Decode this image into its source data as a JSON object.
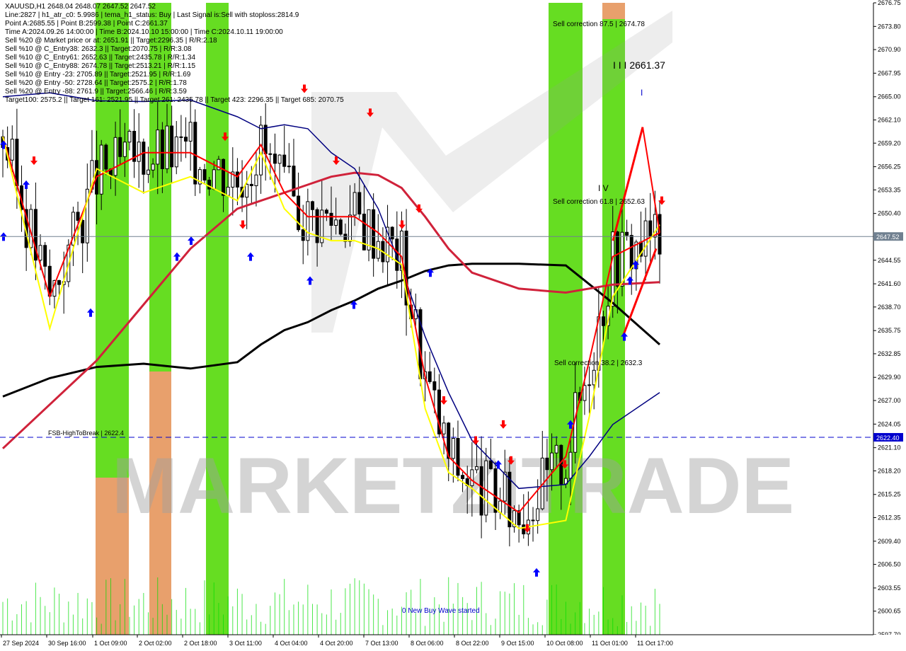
{
  "header": {
    "symbol_line": "XAUUSD,H1  2648.04 2648.07 2647.52 2647.52",
    "info_lines": [
      "Line:2827 | h1_atr_c0: 5.9986 | tema_h1_status: Buy | Last Signal is:Sell with stoploss:2814.9",
      "Point A:2685.55 | Point B:2599.38 | Point C:2661.37",
      "Time A:2024.09.26 14:00:00 | Time B:2024.10.10 15:00:00 | Time C:2024.10.11 19:00:00",
      "Sell %20 @ Market price or at: 2651.91 || Target:2296.35 | R/R:2.18",
      "Sell %10 @ C_Entry38: 2632.3 || Target:2070.75 | R/R:3.08",
      "Sell %10 @ C_Entry61: 2652.63 || Target:2435.78 | R/R:1.34",
      "Sell %10 @ C_Entry88: 2674.78 || Target:2513.21 | R/R:1.15",
      "Sell %10 @ Entry -23: 2705.89 || Target:2521.95 | R/R:1.69",
      "Sell %20 @ Entry -50: 2728.64 || Target:2575.2 | R/R:1.78",
      "Sell %20 @ Entry -88: 2761.9 || Target:2566.46 | R/R:3.59",
      "Target100: 2575.2 || Target 161: 2521.95 || Target 261: 2435.78 || Target 423: 2296.35 || Target 685: 2070.75"
    ]
  },
  "chart_data": {
    "type": "line",
    "symbol": "XAUUSD",
    "timeframe": "H1",
    "ylim": [
      2597.7,
      2676.75
    ],
    "y_ticks": [
      2676.75,
      2673.8,
      2670.9,
      2667.95,
      2665.0,
      2662.1,
      2659.2,
      2656.25,
      2653.35,
      2650.4,
      2647.5,
      2644.55,
      2641.6,
      2638.7,
      2635.75,
      2632.85,
      2629.9,
      2627.0,
      2624.05,
      2621.1,
      2618.2,
      2615.25,
      2612.35,
      2609.4,
      2606.5,
      2603.55,
      2600.65,
      2597.7
    ],
    "x_ticks": [
      "27 Sep 2024",
      "30 Sep 16:00",
      "1 Oct 09:00",
      "2 Oct 02:00",
      "2 Oct 18:00",
      "3 Oct 11:00",
      "4 Oct 04:00",
      "4 Oct 20:00",
      "7 Oct 13:00",
      "8 Oct 06:00",
      "8 Oct 22:00",
      "9 Oct 15:00",
      "10 Oct 08:00",
      "11 Oct 01:00",
      "11 Oct 17:00"
    ],
    "current_price": {
      "value": 2647.52,
      "label": "2647.52"
    },
    "level_line": {
      "value": 2622.4,
      "label": "2622.40",
      "text": "FSB-HighToBreak | 2622.4"
    },
    "annotations": [
      {
        "text": "Sell correction 87.5 | 2674.78"
      },
      {
        "text": "I I I  2661.37"
      },
      {
        "text": "I"
      },
      {
        "text": "I V"
      },
      {
        "text": "Sell correction 61.8 | 2652.63"
      },
      {
        "text": "Sell correction 38.2 | 2632.3"
      },
      {
        "text": "0 New Buy Wave started"
      }
    ],
    "watermark": "MARKETZITRADE",
    "grid": false,
    "colors": {
      "green_zone": "#66dd22",
      "orange_zone": "#e8a06c",
      "candle": "#000000",
      "ma_black": "#000000",
      "ma_crimson": "#d0223a",
      "ma_navy": "#000080",
      "ma_red": "#ff0000",
      "ma_yellow": "#ffff00",
      "buy_arrow": "#0000ff",
      "sell_arrow": "#ff0000",
      "volume": "#00dd00"
    },
    "series": [
      {
        "ma": "black",
        "x": [
          0,
          10,
          20,
          30,
          40,
          50,
          55,
          60,
          65,
          70,
          75,
          80,
          85,
          90,
          95,
          100,
          110,
          120,
          130,
          140
        ],
        "y": [
          2627.5,
          2629.8,
          2631.2,
          2631.6,
          2631.0,
          2631.8,
          2634.0,
          2635.8,
          2636.8,
          2638.3,
          2639.5,
          2641.0,
          2642.0,
          2643.2,
          2643.9,
          2644.1,
          2644.1,
          2643.9,
          2639.2,
          2634.0
        ]
      },
      {
        "ma": "crimson",
        "x": [
          0,
          10,
          20,
          30,
          40,
          50,
          55,
          60,
          65,
          70,
          75,
          80,
          85,
          90,
          95,
          100,
          110,
          120,
          130,
          140
        ],
        "y": [
          2621.0,
          2626.5,
          2632.0,
          2639.0,
          2646.0,
          2651.0,
          2652.0,
          2653.0,
          2654.0,
          2655.0,
          2655.5,
          2655.2,
          2653.6,
          2650.0,
          2646.0,
          2643.0,
          2641.0,
          2640.5,
          2641.5,
          2641.8
        ]
      },
      {
        "ma": "navy",
        "x": [
          0,
          10,
          20,
          30,
          40,
          50,
          55,
          60,
          65,
          70,
          75,
          80,
          85,
          90,
          95,
          100,
          110,
          120,
          125,
          130,
          140
        ],
        "y": [
          2665.0,
          2665.5,
          2664.5,
          2664.4,
          2664.6,
          2662.5,
          2661.0,
          2661.5,
          2661.0,
          2658.0,
          2656.0,
          2651.0,
          2643.5,
          2635.0,
          2628.0,
          2622.0,
          2616.0,
          2616.5,
          2620.0,
          2624.0,
          2628.0
        ]
      },
      {
        "ma": "red",
        "x": [
          0,
          10,
          20,
          30,
          40,
          50,
          55,
          60,
          65,
          70,
          75,
          80,
          85,
          90,
          95,
          100,
          110,
          120,
          125,
          130,
          140
        ],
        "y": [
          2660.0,
          2640.0,
          2655.0,
          2658.0,
          2658.0,
          2655.0,
          2659.0,
          2653.0,
          2650.0,
          2650.0,
          2650.0,
          2648.0,
          2645.0,
          2630.0,
          2620.0,
          2617.0,
          2613.0,
          2620.0,
          2632.0,
          2645.0,
          2648.0
        ]
      },
      {
        "ma": "yellow",
        "x": [
          0,
          10,
          20,
          30,
          40,
          50,
          55,
          60,
          65,
          70,
          75,
          80,
          85,
          90,
          95,
          100,
          110,
          120,
          125,
          130,
          140
        ],
        "y": [
          2660.0,
          2636.0,
          2656.0,
          2653.0,
          2655.0,
          2652.0,
          2658.0,
          2651.0,
          2648.0,
          2647.0,
          2647.0,
          2646.0,
          2644.0,
          2626.0,
          2618.0,
          2616.0,
          2611.0,
          2612.0,
          2625.0,
          2640.0,
          2649.0
        ]
      }
    ]
  }
}
